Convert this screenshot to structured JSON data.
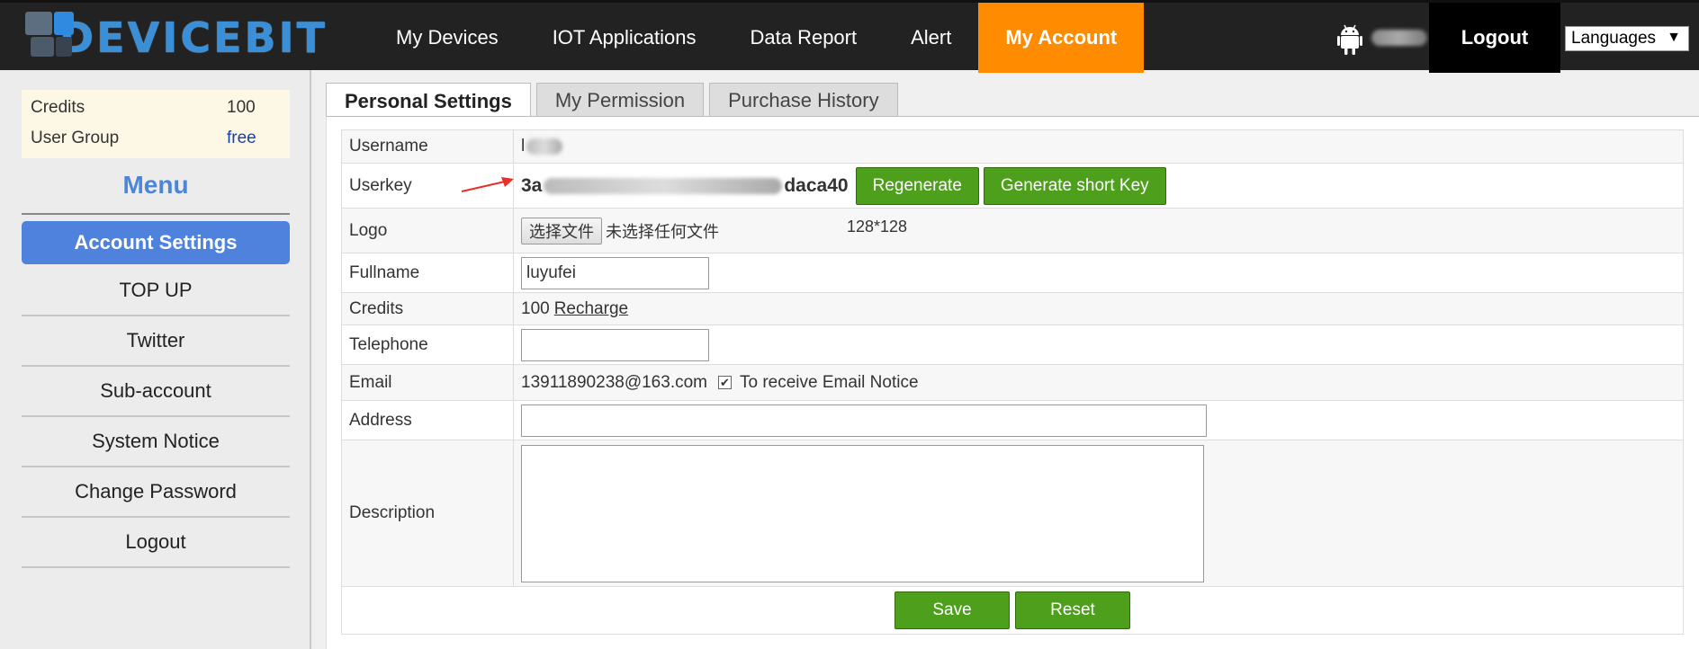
{
  "brand": {
    "name": "DEVICEBIT"
  },
  "nav": {
    "items": [
      {
        "label": "My Devices"
      },
      {
        "label": "IOT Applications"
      },
      {
        "label": "Data Report"
      },
      {
        "label": "Alert"
      },
      {
        "label": "My Account"
      }
    ],
    "active_index": 4,
    "logout_label": "Logout",
    "language_label": "Languages",
    "language_arrow": "▼"
  },
  "sidebar": {
    "info": [
      {
        "label": "Credits",
        "value": "100"
      },
      {
        "label": "User Group",
        "value": "free"
      }
    ],
    "menu_title": "Menu",
    "menu_items": [
      {
        "label": "Account Settings"
      },
      {
        "label": "TOP UP"
      },
      {
        "label": "Twitter"
      },
      {
        "label": "Sub-account"
      },
      {
        "label": "System Notice"
      },
      {
        "label": "Change Password"
      },
      {
        "label": "Logout"
      }
    ]
  },
  "tabs": [
    {
      "label": "Personal Settings"
    },
    {
      "label": "My Permission"
    },
    {
      "label": "Purchase History"
    }
  ],
  "form": {
    "username": {
      "label": "Username",
      "value": "l"
    },
    "userkey": {
      "label": "Userkey",
      "value_start": "3a",
      "value_end": "daca40",
      "regenerate": "Regenerate",
      "short_key": "Generate short Key"
    },
    "logo": {
      "label": "Logo",
      "file_button": "选择文件",
      "file_status": "未选择任何文件",
      "hint": "128*128"
    },
    "fullname": {
      "label": "Fullname",
      "value": "luyufei"
    },
    "credits": {
      "label": "Credits",
      "value": "100",
      "link": "Recharge"
    },
    "telephone": {
      "label": "Telephone",
      "value": ""
    },
    "email": {
      "label": "Email",
      "value": "13911890238@163.com",
      "notice_label": "To receive Email Notice",
      "notice_checked": true
    },
    "address": {
      "label": "Address",
      "value": ""
    },
    "description": {
      "label": "Description",
      "value": ""
    },
    "save": "Save",
    "reset": "Reset"
  },
  "colors": {
    "accent_orange": "#ff8c00",
    "brand_blue": "#3a8fd6",
    "menu_blue": "#4f82dc",
    "button_green": "#4ea01c",
    "arrow_red": "#e8302a"
  }
}
